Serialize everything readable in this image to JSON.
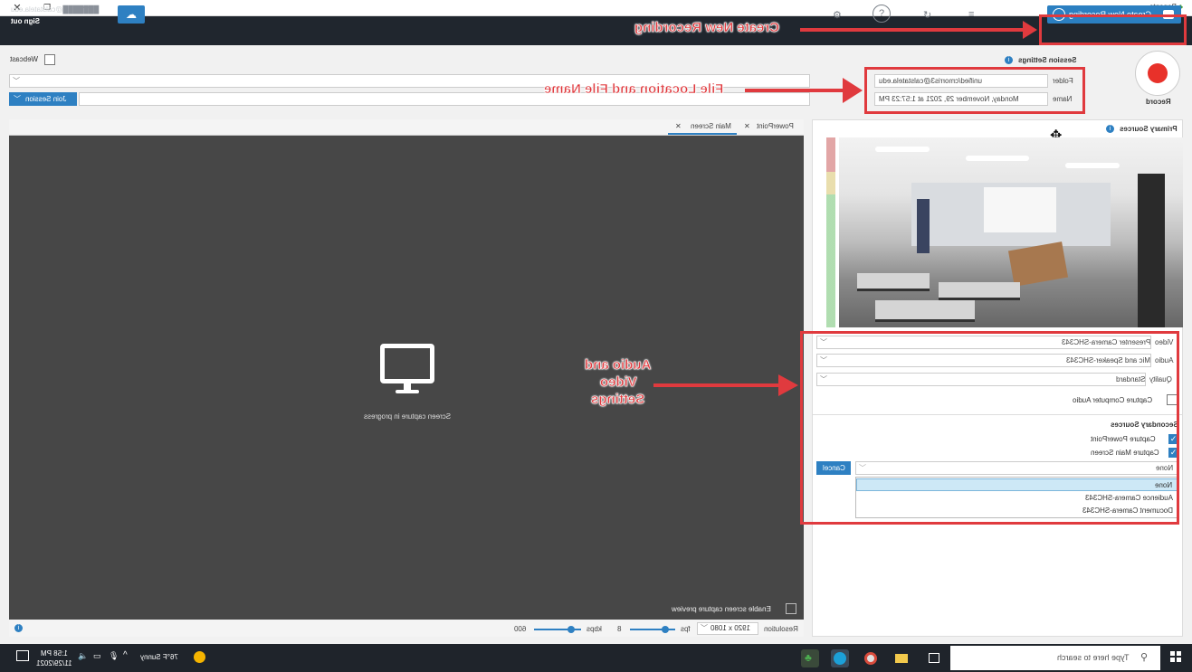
{
  "window": {
    "app_title": "Panopto",
    "controls": [
      "✕",
      "❐",
      "—"
    ]
  },
  "topbar": {
    "user_email": "@calstatela.edu",
    "sign_out": "Sign out",
    "create_new_recording": "Create New Recording"
  },
  "session": {
    "webcast_label": "Webcast",
    "join_session": "Join Session",
    "settings_title": "Session Settings",
    "folder_label": "Folder",
    "folder_value": "unified/cmorris3@calstatela.edu",
    "name_label": "Name",
    "name_value": "Monday, November 29, 2021 at 1:57:23 PM",
    "record_label": "Record"
  },
  "preview": {
    "tabs": [
      {
        "label": "PowerPoint"
      },
      {
        "label": "Main Screen"
      }
    ],
    "capture_message": "Screen capture in progress",
    "enable_preview_label": "Enable screen capture preview"
  },
  "bottom_bar": {
    "resolution_label": "Resolution",
    "resolution_value": "1920 x 1080",
    "fps_label": "fps",
    "fps_value": "8",
    "kbps_label": "kbps",
    "kbps_value": "600"
  },
  "primary_sources": {
    "title": "Primary Sources",
    "video_label": "Video",
    "video_value": "Presenter Camera-SHC343",
    "audio_label": "Audio",
    "audio_value": "Mic and Speaker-SHC343",
    "quality_label": "Quality",
    "quality_value": "Standard",
    "capture_computer_audio": "Capture Computer Audio"
  },
  "secondary_sources": {
    "title": "Secondary Sources",
    "capture_powerpoint": "Capture PowerPoint",
    "capture_main_screen": "Capture Main Screen",
    "cancel": "Cancel",
    "select_value": "None",
    "options": [
      "None",
      "Audience Camera-SHC343",
      "Document Camera-SHC343"
    ]
  },
  "annotations": {
    "create": "Create New Recording",
    "file": "File Location and File Name",
    "av_line1": "Audio and",
    "av_line2": "Video",
    "av_line3": "Settings"
  },
  "taskbar": {
    "search_placeholder": "Type here to search",
    "weather": "76°F  Sunny",
    "time": "1:58 PM",
    "date": "11/29/2021"
  },
  "colors": {
    "accent": "#2e80c2",
    "annotation": "#e03a3e",
    "record": "#e8312a",
    "preview_bg": "#474747",
    "topbar_bg": "#20262e"
  }
}
